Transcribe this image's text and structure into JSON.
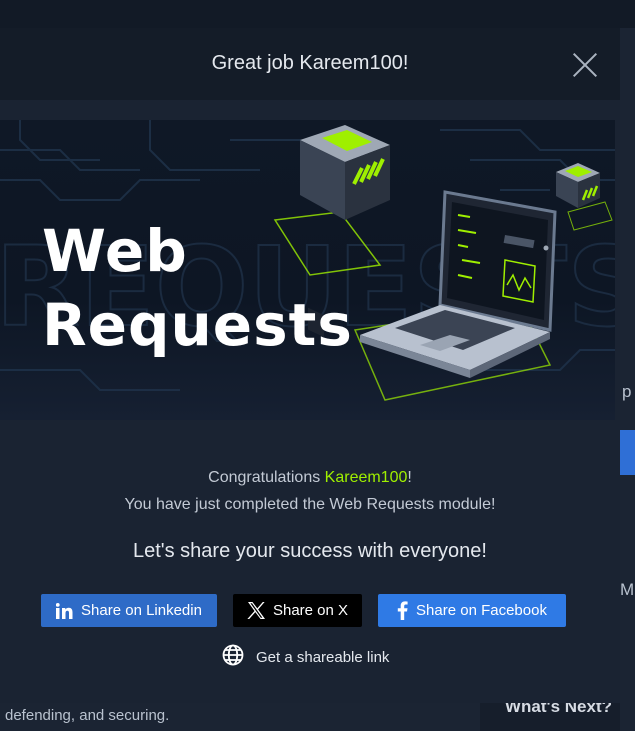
{
  "modal": {
    "title": "Great job Kareem100!",
    "banner_title": "Web\nRequests",
    "congrats_prefix": "Congratulations ",
    "username": "Kareem100",
    "congrats_suffix": "!",
    "completed_text": "You have just completed the Web Requests module!",
    "share_heading": "Let's share your success with everyone!",
    "buttons": {
      "linkedin": "Share on Linkedin",
      "x": "Share on X",
      "facebook": "Share on Facebook"
    },
    "link_label": "Get a shareable link"
  },
  "background": {
    "right_text_1": "p",
    "right_text_2": "M",
    "bottom_text": "defending, and securing.",
    "whats_next": "What's Next?"
  },
  "colors": {
    "accent_green": "#9fef00",
    "linkedin": "#2e6bc7",
    "x": "#000000",
    "facebook": "#2f7ae5"
  },
  "icons": [
    "close-icon",
    "linkedin-icon",
    "x-icon",
    "facebook-icon",
    "globe-icon"
  ]
}
